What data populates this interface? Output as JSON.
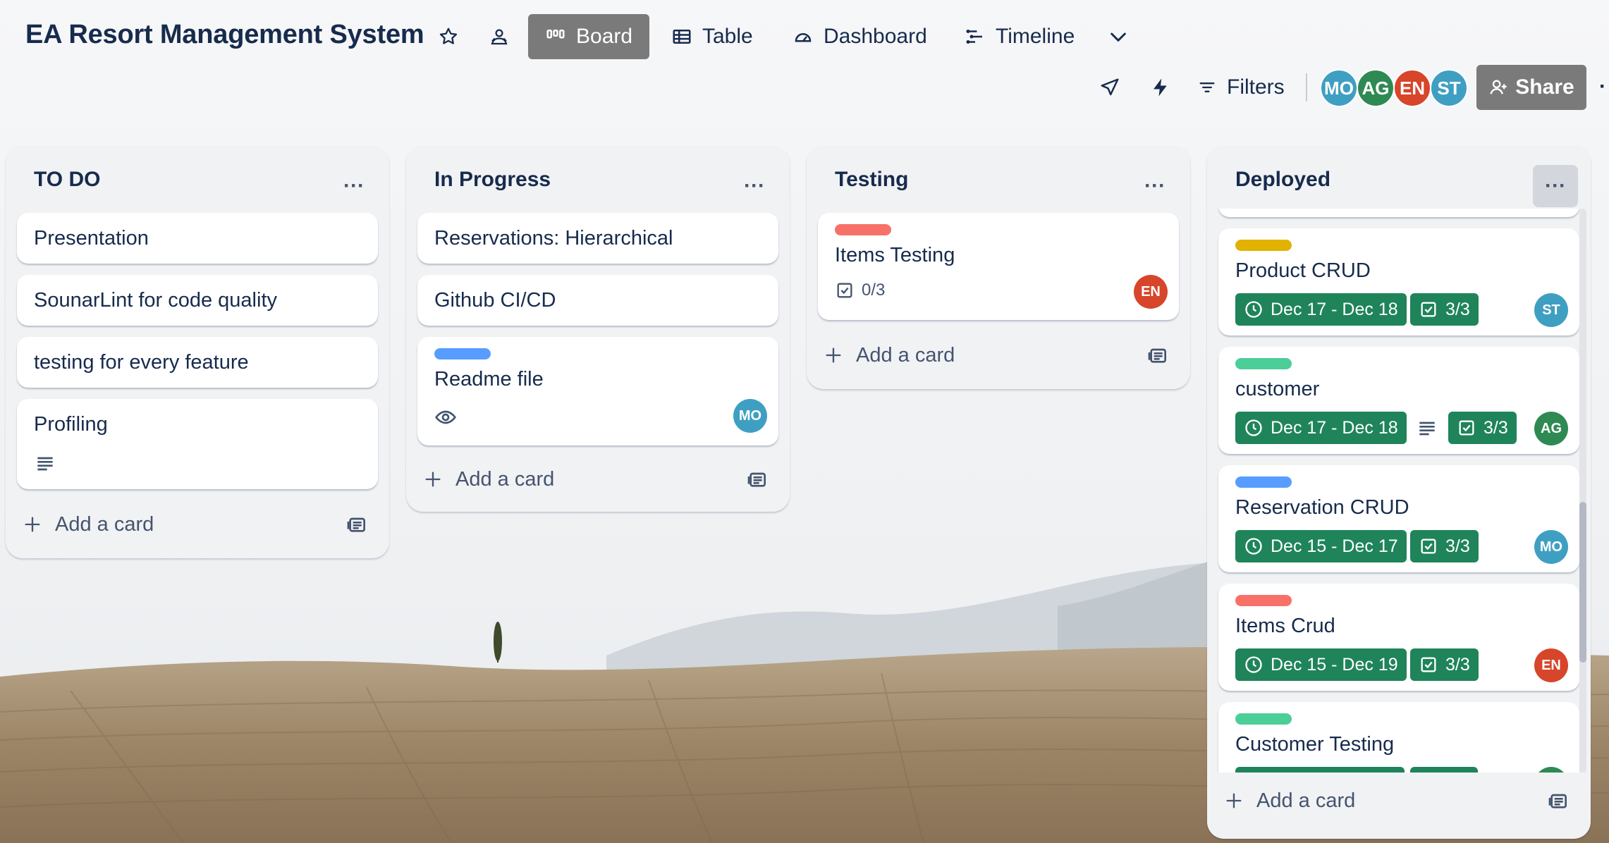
{
  "board": {
    "title": "EA Resort Management System",
    "views": [
      {
        "label": "Board",
        "icon": "board-icon",
        "active": true
      },
      {
        "label": "Table",
        "icon": "table-icon"
      },
      {
        "label": "Dashboard",
        "icon": "dashboard-icon"
      },
      {
        "label": "Timeline",
        "icon": "timeline-icon"
      }
    ],
    "filters_label": "Filters",
    "share_label": "Share",
    "members": [
      {
        "initials": "MO",
        "color": "#3f9fc2"
      },
      {
        "initials": "AG",
        "color": "#2e8a52"
      },
      {
        "initials": "EN",
        "color": "#d7452a"
      },
      {
        "initials": "ST",
        "color": "#3f9fc2"
      }
    ]
  },
  "lists": [
    {
      "title": "TO DO",
      "cards": [
        {
          "title": "Presentation"
        },
        {
          "title": "SounarLint for code quality"
        },
        {
          "title": "testing for every feature"
        },
        {
          "title": "Profiling",
          "has_description": true
        }
      ],
      "add_card": "Add a card"
    },
    {
      "title": "In Progress",
      "cards": [
        {
          "title": "Reservations: Hierarchical"
        },
        {
          "title": "Github CI/CD"
        },
        {
          "title": "Readme file",
          "label_color": "#579dff",
          "watching": true,
          "member": "MO"
        }
      ],
      "add_card": "Add a card"
    },
    {
      "title": "Testing",
      "cards": [
        {
          "title": "Items Testing",
          "label_color": "#f87168",
          "checklist": "0/3",
          "member": "EN"
        }
      ],
      "add_card": "Add a card"
    },
    {
      "title": "Deployed",
      "cards": [
        {
          "title": "Product CRUD",
          "label_color": "#e2b203",
          "dates": "Dec 17 - Dec 18",
          "checklist": "3/3",
          "member": "ST"
        },
        {
          "title": "customer",
          "label_color": "#4bce97",
          "dates": "Dec 17 - Dec 18",
          "checklist": "3/3",
          "member": "AG",
          "has_description": true
        },
        {
          "title": "Reservation CRUD",
          "label_color": "#579dff",
          "dates": "Dec 15 - Dec 17",
          "checklist": "3/3",
          "member": "MO"
        },
        {
          "title": "Items Crud",
          "label_color": "#f87168",
          "dates": "Dec 15 - Dec 19",
          "checklist": "3/3",
          "member": "EN"
        },
        {
          "title": "Customer Testing",
          "label_color": "#4bce97"
        }
      ],
      "add_card": "Add a card"
    }
  ],
  "colors": {
    "badge_green": "#1f845a",
    "avatar_blue": "#3f9fc2",
    "avatar_green": "#2e8a52",
    "avatar_red": "#d7452a"
  }
}
